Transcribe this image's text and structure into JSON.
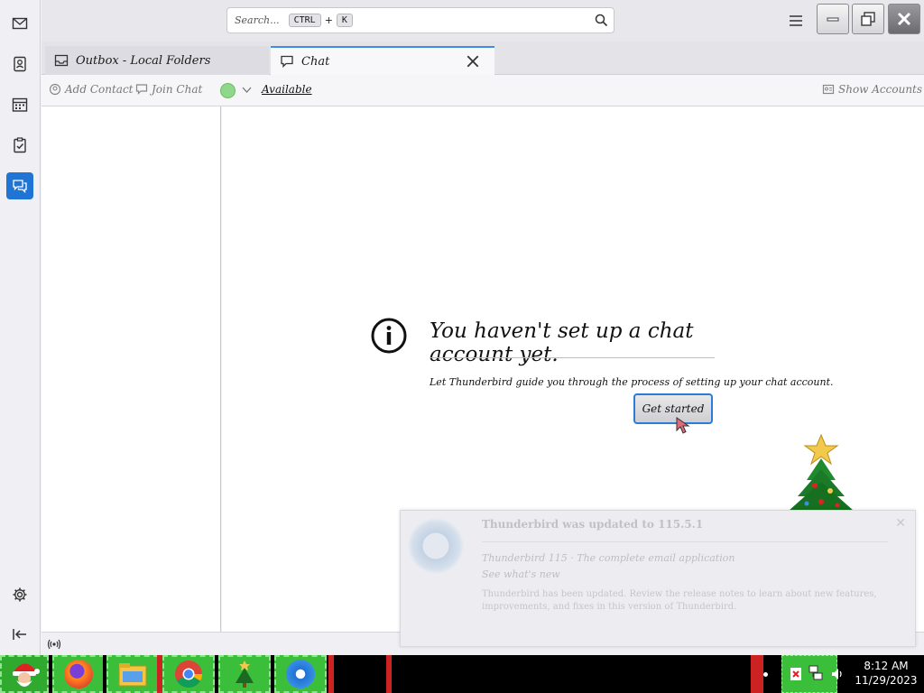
{
  "search": {
    "placeholder": "Search...",
    "shortcut_key1": "CTRL",
    "shortcut_sep": "+",
    "shortcut_key2": "K"
  },
  "tabs": [
    {
      "label": "Outbox - Local Folders",
      "active": false
    },
    {
      "label": "Chat",
      "active": true
    }
  ],
  "chat_toolbar": {
    "add_contact": "Add Contact",
    "join_chat": "Join Chat",
    "status": "Available",
    "show_accounts": "Show Accounts"
  },
  "empty_state": {
    "title": "You haven't set up a chat account yet.",
    "description": "Let Thunderbird guide you through the process of setting up your chat account.",
    "button": "Get started"
  },
  "notification": {
    "title": "Thunderbird was updated to 115.5.1",
    "line1": "Thunderbird 115 · The complete email application",
    "line2": "See what's new",
    "body": "Thunderbird has been updated. Review the release notes to learn about new features, improvements, and fixes in this version of Thunderbird."
  },
  "taskbar": {
    "apps": [
      "Santa",
      "Firefox",
      "File Explorer",
      "Chrome",
      "Christmas Tree",
      "Thunderbird"
    ],
    "clock_time": "8:12 AM",
    "clock_date": "11/29/2023"
  },
  "colors": {
    "accent": "#1f74d4",
    "status_available": "#8fd88a",
    "taskbar_green": "#3bbf3b"
  }
}
